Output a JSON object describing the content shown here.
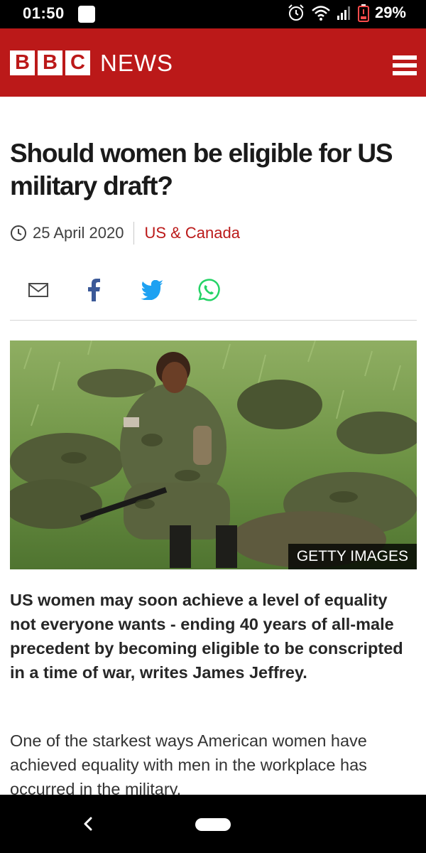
{
  "status_bar": {
    "time": "01:50",
    "battery_percent": "29%",
    "icons": [
      "alarm-icon",
      "wifi-icon",
      "signal-icon",
      "battery-icon"
    ]
  },
  "header": {
    "logo_letters": [
      "B",
      "B",
      "C"
    ],
    "section_word": "NEWS",
    "brand_color": "#bb1919",
    "menu_icon": "hamburger-menu-icon"
  },
  "article": {
    "headline": "Should women be eligible for US military draft?",
    "date": "25 April 2020",
    "section": "US & Canada",
    "share_icons": [
      "email-icon",
      "facebook-icon",
      "twitter-icon",
      "whatsapp-icon"
    ],
    "image_credit": "GETTY IMAGES",
    "intro": "US women may soon achieve a level of equality not everyone wants - ending 40 years of all-male precedent by becoming eligible to be conscripted in a time of war, writes James Jeffrey.",
    "body_start": "One of the starkest ways American women have achieved equality with men in the workplace has occurred in the military."
  },
  "nav_bar": {
    "icons": [
      "back-icon",
      "home-pill-icon"
    ]
  }
}
